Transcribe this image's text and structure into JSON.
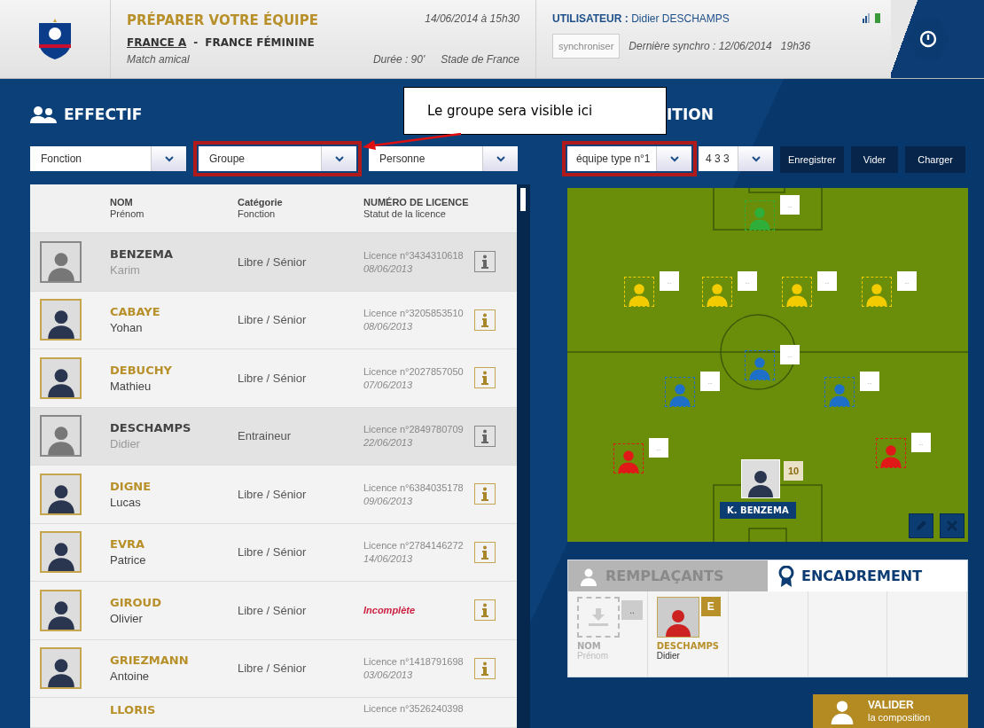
{
  "header": {
    "title": "PRÉPARER VOTRE ÉQUIPE",
    "team": "FRANCE A",
    "separator": "-",
    "opponent": "FRANCE FÉMININE",
    "match_type": "Match amical",
    "datetime": "14/06/2014 à 15h30",
    "duration": "Durée : 90'",
    "venue": "Stade de France",
    "user_label": "UTILISATEUR :",
    "user_name": "Didier DESCHAMPS",
    "sync_button": "synchroniser",
    "last_sync": "Dernière synchro : 12/06/2014",
    "last_sync_time": "19h36"
  },
  "effectif": {
    "title": "EFFECTIF",
    "filters": [
      {
        "label": "Fonction",
        "highlighted": false
      },
      {
        "label": "Groupe",
        "highlighted": true
      },
      {
        "label": "Personne",
        "highlighted": false
      }
    ],
    "columns": [
      {
        "title": "NOM",
        "subtitle": "Prénom"
      },
      {
        "title": "Catégorie",
        "subtitle": "Fonction"
      },
      {
        "title": "NUMÉRO DE LICENCE",
        "subtitle": "Statut de la licence"
      }
    ],
    "rows": [
      {
        "last_name": "BENZEMA",
        "first_name": "Karim",
        "category": "Libre / Sénior",
        "licence": "Licence n°3434310618",
        "date": "08/06/2013",
        "placed": true,
        "incomplete": false
      },
      {
        "last_name": "CABAYE",
        "first_name": "Yohan",
        "category": "Libre / Sénior",
        "licence": "Licence n°3205853510",
        "date": "08/06/2013",
        "placed": false,
        "incomplete": false
      },
      {
        "last_name": "DEBUCHY",
        "first_name": "Mathieu",
        "category": "Libre / Sénior",
        "licence": "Licence n°2027857050",
        "date": "07/06/2013",
        "placed": false,
        "incomplete": false
      },
      {
        "last_name": "DESCHAMPS",
        "first_name": "Didier",
        "category": "Entraineur",
        "licence": "Licence n°2849780709",
        "date": "22/06/2013",
        "placed": true,
        "incomplete": false
      },
      {
        "last_name": "DIGNE",
        "first_name": "Lucas",
        "category": "Libre / Sénior",
        "licence": "Licence n°6384035178",
        "date": "09/06/2013",
        "placed": false,
        "incomplete": false
      },
      {
        "last_name": "EVRA",
        "first_name": "Patrice",
        "category": "Libre / Sénior",
        "licence": "Licence n°2784146272",
        "date": "14/06/2013",
        "placed": false,
        "incomplete": false
      },
      {
        "last_name": "GIROUD",
        "first_name": "Olivier",
        "category": "Libre / Sénior",
        "licence": "Incomplète",
        "placed": false,
        "incomplete": true
      },
      {
        "last_name": "GRIEZMANN",
        "first_name": "Antoine",
        "category": "Libre / Sénior",
        "licence": "Licence n°1418791698",
        "date": "03/06/2013",
        "placed": false,
        "incomplete": false
      },
      {
        "last_name": "LLORIS",
        "licence": "Licence n°3526240398",
        "placed": false,
        "incomplete": false
      }
    ]
  },
  "composition": {
    "title": "ITION",
    "team_select": {
      "label": "équipe type n°1",
      "highlighted": true
    },
    "formation_select": {
      "label": "4 3 3",
      "highlighted": false
    },
    "buttons": [
      "Enregistrer",
      "Vider",
      "Charger"
    ],
    "slots": [
      {
        "kind": "empty",
        "color": "#2fae3a",
        "label": ".."
      },
      {
        "kind": "empty",
        "color": "#f2cc00",
        "label": ".."
      },
      {
        "kind": "empty",
        "color": "#f2cc00",
        "label": ".."
      },
      {
        "kind": "empty",
        "color": "#f2cc00",
        "label": ".."
      },
      {
        "kind": "empty",
        "color": "#f2cc00",
        "label": ".."
      },
      {
        "kind": "empty",
        "color": "#1e6fc8",
        "label": ".."
      },
      {
        "kind": "empty",
        "color": "#1e6fc8",
        "label": ".."
      },
      {
        "kind": "empty",
        "color": "#1e6fc8",
        "label": ".."
      },
      {
        "kind": "empty",
        "color": "#e01818",
        "label": ".."
      },
      {
        "kind": "empty",
        "color": "#e01818",
        "label": ".."
      },
      {
        "kind": "player",
        "number": "10",
        "name": "K. BENZEMA"
      }
    ],
    "tabs": [
      {
        "label": "REMPLAÇANTS",
        "selected": false
      },
      {
        "label": "ENCADREMENT",
        "selected": true
      }
    ],
    "staff": [
      {
        "kind": "empty",
        "label": "..",
        "last_name": "NOM",
        "first_name": "Prénom"
      },
      {
        "kind": "person",
        "badge": "E",
        "last_name": "DESCHAMPS",
        "first_name": "Didier"
      },
      {
        "kind": "blank"
      },
      {
        "kind": "blank"
      },
      {
        "kind": "blank"
      }
    ],
    "validate": {
      "title": "VALIDER",
      "subtitle": "la composition"
    }
  },
  "annotation": {
    "text": "Le groupe sera visible ici"
  }
}
